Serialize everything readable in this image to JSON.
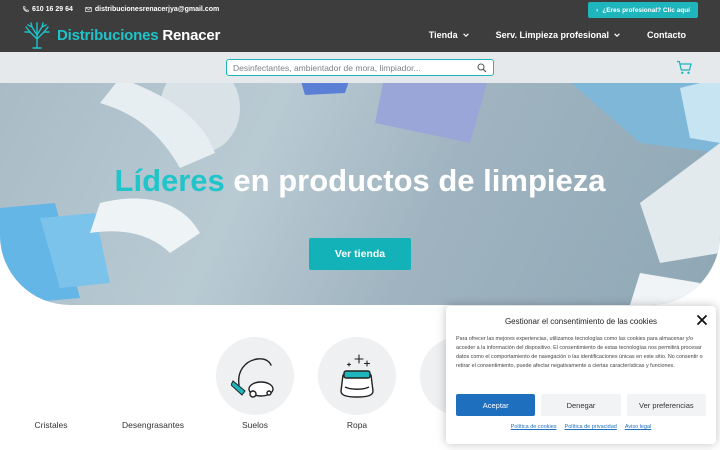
{
  "topbar": {
    "phone": "610 16 29 64",
    "email": "distribucionesrenacerjya@gmail.com",
    "pro_button": "¿Eres profesional? Clic aquí"
  },
  "logo": {
    "text_a": "Distribuciones",
    "text_b": "Renacer"
  },
  "nav": {
    "items": [
      {
        "label": "Tienda",
        "has_dropdown": true
      },
      {
        "label": "Serv. Limpieza profesional",
        "has_dropdown": true
      },
      {
        "label": "Contacto",
        "has_dropdown": false
      }
    ]
  },
  "search": {
    "placeholder": "Desinfectantes, ambientador de mora, limpiador..."
  },
  "hero": {
    "title_accent": "Líderes",
    "title_rest": " en productos de limpieza",
    "button": "Ver tienda"
  },
  "categories": [
    {
      "label": "Cristales",
      "icon": "window-cleaner-icon"
    },
    {
      "label": "Desengrasantes",
      "icon": "degreaser-icon"
    },
    {
      "label": "Suelos",
      "icon": "vacuum-cleaner-icon"
    },
    {
      "label": "Ropa",
      "icon": "laundry-detergent-icon"
    }
  ],
  "cookie": {
    "title": "Gestionar el consentimiento de las cookies",
    "text": "Para ofrecer las mejores experiencias, utilizamos tecnologías como las cookies para almacenar y/o acceder a la información del dispositivo. El consentimiento de estas tecnologías nos permitirá procesar datos como el comportamiento de navegación o las identificaciones únicas en este sitio. No consentir o retirar el consentimiento, puede afectar negativamente a ciertas características y funciones.",
    "accept": "Aceptar",
    "deny": "Denegar",
    "preferences": "Ver preferencias",
    "links": [
      "Política de cookies",
      "Política de privacidad",
      "Aviso legal"
    ]
  },
  "colors": {
    "dark_bar": "#3d3d3d",
    "accent_teal": "#1eb5bd",
    "accept_blue": "#1f6fbf"
  }
}
